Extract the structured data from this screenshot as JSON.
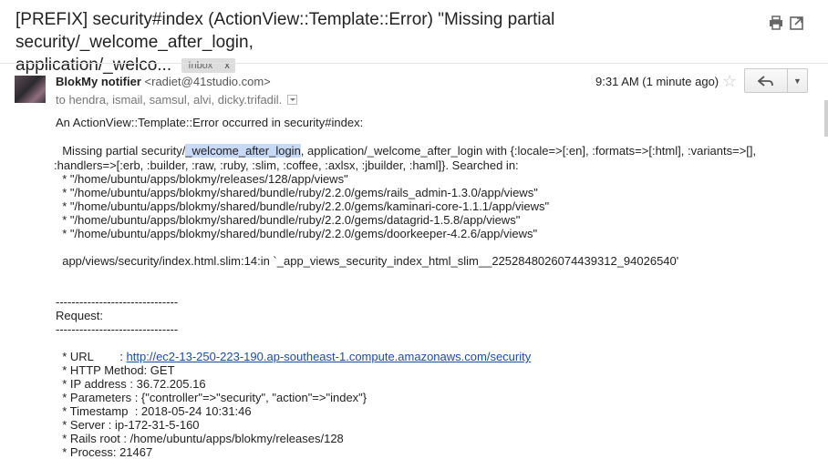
{
  "subject": {
    "line1": "[PREFIX] security#index (ActionView::Template::Error) \"Missing partial security/_welcome_after_login,",
    "line2": "application/_welco...",
    "label": "Inbox",
    "label_close": "x"
  },
  "toolbar": {
    "print_icon": "print-icon",
    "newwindow_icon": "new-window-icon"
  },
  "message": {
    "sender_name": "BlokMy notifier",
    "sender_email": "<radiet@41studio.com>",
    "recipients": "to hendra, ismail, samsul, alvi, dicky.trifadil.",
    "time": "9:31 AM (1 minute ago)",
    "star": "☆",
    "reply_icon": "reply-icon",
    "more_icon": "▼"
  },
  "body": {
    "intro": "An ActionView::Template::Error occurred in security#index:",
    "err_pre": "  Missing partial security/",
    "err_hl": "_welcome_after_login",
    "err_post": ", application/_welcome_after_login with {:locale=>[:en], :formats=>[:html], :variants=>[],",
    "err_l2": ":handlers=>[:erb, :builder, :raw, :ruby, :slim, :coffee, :axlsx, :jbuilder, :haml]}. Searched in:",
    "paths": [
      "  * \"/home/ubuntu/apps/blokmy/releases/128/app/views\"",
      "  * \"/home/ubuntu/apps/blokmy/shared/bundle/ruby/2.2.0/gems/rails_admin-1.3.0/app/views\"",
      "  * \"/home/ubuntu/apps/blokmy/shared/bundle/ruby/2.2.0/gems/kaminari-core-1.1.1/app/views\"",
      "  * \"/home/ubuntu/apps/blokmy/shared/bundle/ruby/2.2.0/gems/datagrid-1.5.8/app/views\"",
      "  * \"/home/ubuntu/apps/blokmy/shared/bundle/ruby/2.2.0/gems/doorkeeper-4.2.6/app/views\""
    ],
    "trace": "  app/views/security/index.html.slim:14:in `_app_views_security_index_html_slim__2252848026074439312_94026540'",
    "sep1": "-------------------------------",
    "request_heading": "Request:",
    "sep2": "-------------------------------",
    "url_label": "  * URL        : ",
    "url": "http://ec2-13-250-223-190.ap-southeast-1.compute.amazonaws.com/security",
    "details": [
      "  * HTTP Method: GET",
      "  * IP address : 36.72.205.16",
      "  * Parameters : {\"controller\"=>\"security\", \"action\"=>\"index\"}",
      "  * Timestamp  : 2018-05-24 10:31:46",
      "  * Server : ip-172-31-5-160",
      "  * Rails root : /home/ubuntu/apps/blokmy/releases/128",
      "  * Process: 21467"
    ]
  }
}
